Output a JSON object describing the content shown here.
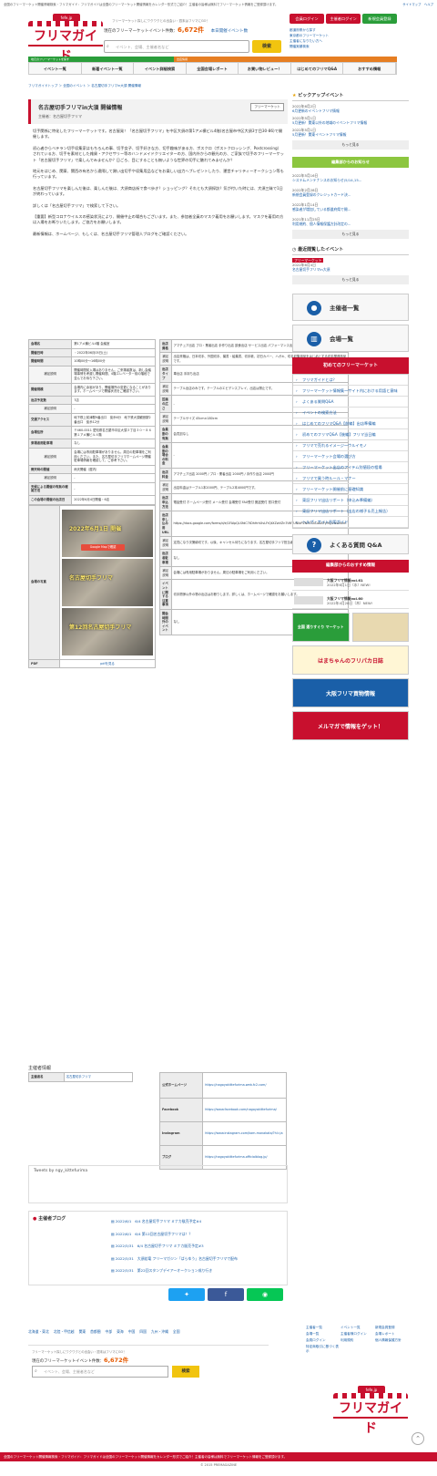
{
  "topbar": {
    "text": "全国のフリーマーケット開催情報検索・フリマガイド：フリマガイドは全国のフリーマーケット開催情報をカレンダー形式でご紹介！主催者の皆様は無料でフリーマーケット情報をご登録頂けます。",
    "links": "サイトマップ　ヘルプ"
  },
  "header": {
    "logo_small": "fefe.jp",
    "logo_text": "フリマガイド",
    "tagline": "フリーマーケット探しにワクワクとの出会い・週末はフリマにGO！",
    "count_label": "現在のフリーマーケットイベント件数：",
    "count_value": "6,672件",
    "count_link": "本日開催イベント数",
    "search_placeholder": "イベント、会場、主催者名など",
    "search_button": "検索",
    "btn_login": "会員ログイン",
    "btn_org_login": "主催者ログイン",
    "btn_register": "新規会員登録",
    "links": [
      "都道府県から探す",
      "東京都のフリーマーケット",
      "主催者になりたい方へ",
      "開催実績検索"
    ],
    "strip1": "地元のフリーマーケットを探す",
    "strip2": "出店情報"
  },
  "nav": [
    "イベント一覧",
    "新着イベント一覧",
    "イベント詳細検索",
    "全国会場レポート",
    "お買い物レビュー！",
    "はじめてのフリマQ&A",
    "おすすめ情報"
  ],
  "breadcrumb": "フリマガイドトップ ＞ 全国のイベント ＞ 名古屋切手フリマin大須 開催情報",
  "event": {
    "title": "名古屋切手フリマin大須 開催情報",
    "organizer_line": "主催者：名古屋切手フリマ",
    "tag": "フリーマーケット",
    "paragraphs": [
      "切手関係に特化したフリーマーケットです。名古屋発！「名古屋切手フリマ」を中区大須の第1アメ横ビル4階(名古屋市中区大須3丁目30-86)で開催します。",
      "初心者からベテラン切手収集家はもちろんの事、切手女子、切手好きな方、切手趣味がある方、ポスクロ（ポストクロッシング、Postcrossing）されている方、切手を素材とした雑貨・アクセサリー等のハンドメイドクリエイターの方、国内外からの観光の方、ご家族で切手のフリーマーケット「名古屋切手フリマ」で楽しんでみませんか？日ごろ、目にすることも無いような世界の切手に触れてみませんか？",
      "地元をはじめ、関東、関西の有名から遠隔して謝い出切手や収集用品などをお楽しい出力ヘブレゼントしたり、運営チャリティーオークション等も行っています。",
      "名古屋切手フリマを楽しんだ後は、楽しんだ後は、大須商店街で食べ歩き？ショッピング？それとも大須探訪？気が付いた時には、大須三昧で1日が終わっています。",
      "詳しくは「名古屋切手フリマ」で検索して下さい。",
      "【重要】新型コロナウイルスの感染状況により、開催中止の場合もございます。また、参加者全員のマスク着用をお願いします。マスクを着用の方は入場をお断りいたします。ご協力をお願いします。",
      "最新情報は、ホームページ、もしくは、名古屋切手フリマ管理人ブログをご確認ください。"
    ]
  },
  "left_table": [
    {
      "k": "会場名",
      "v": "第1アメ横ビル4階 会議室"
    },
    {
      "k": "開催日時",
      "v": "・2022年06月05日(土)"
    },
    {
      "k": "開催時間",
      "v": "10時00分〜16時00分"
    },
    {
      "k": "補足説明",
      "v": "開催時間前入場はありません。ご来場者数は、新し会議場事情を考慮し開催時間、4階エレベーター前の階段で並んでお待ち下さい。"
    },
    {
      "k": "開催規模",
      "v": "会場内に余裕があり、開催場所の変更になることがあります。ホームページで開催状況をご確認下さい。"
    },
    {
      "k": "出店予定数",
      "v": "7店"
    },
    {
      "k": "補足説明",
      "v": "-"
    },
    {
      "k": "交通アクセス",
      "v": "地下鉄上前津駅9番出口　徒歩6分　地下鉄大須観音駅2番出口　徒歩12分"
    },
    {
      "k": "会場住所",
      "v": "〒460-0011 愛知県名古屋市中区大須３丁目３０－８６ 第１アメ横ビル４階"
    },
    {
      "k": "来場者用駐車場",
      "v": "なし"
    },
    {
      "k": "補足説明",
      "v": "会場には専用駐車場がありません。周辺の駐車場をご利用ください。また、名古屋切手フリマホームページ開催駐車場情報を確認して、ご参考下さい。"
    },
    {
      "k": "雨天時の開催",
      "v": "雨天開催（屋内）"
    },
    {
      "k": "補足説明",
      "v": "-"
    },
    {
      "k": "天候による開催の有無の確認方法",
      "v": "-"
    },
    {
      "k": "この会場の開催の出店日",
      "v": "2022年6月4日開催・6店"
    }
  ],
  "photos": [
    "2022年6月1日 開催",
    "名古屋切手フリマ",
    "第12回名古屋切手フリマ"
  ],
  "pdf": {
    "k": "PDF",
    "v": "pdfを見る"
  },
  "map_btn": "Google Mapで確認",
  "right_table": [
    {
      "k": "出店資格",
      "v": "アマチュア出店 プロ・業者出店 手作り出店 飲食出店 サービス出店 パフォーマンス出店 企業出店"
    },
    {
      "k": "補足説明",
      "v": "出店資格は、日本切手、外国切手、葉書・絵葉書、切手帳、初日カバー、ハガキ、切手収集用品をはじめとする切手関連商品です。"
    },
    {
      "k": "出店タイプ",
      "v": "車出店 手持ち出店"
    },
    {
      "k": "補足説明",
      "v": "テーブル出店のみです。テーブルのエビデンスプレイ、出店は禁止です。"
    },
    {
      "k": "区画の広さ",
      "v": "-"
    },
    {
      "k": "補足説明",
      "v": "テーブルサイズ 45cm×180cm"
    },
    {
      "k": "会員割の有無",
      "v": "会員割なし"
    },
    {
      "k": "会員割の場合の料金",
      "v": "-"
    },
    {
      "k": "出店料金",
      "v": "アマチュア出店 2000円 / プロ・業者出店 2000円 / 手作り出店 2000円"
    },
    {
      "k": "補足説明",
      "v": "出店料金はテーブル1本2000円、テーブル2本4000円です。"
    },
    {
      "k": "出店申込方法",
      "v": "電話受付 ホームページ受付 メール受付 会場受付 FAX受付 郵送受付 窓口受付"
    },
    {
      "k": "出店申し込み用URL",
      "v": "https://docs.google.com/forms/d/e/1FAIpQLSfdC7tDhHrhXvLFrQtXZwVZn7tWYUNlbPZNATS4CabAPy9Q/viewform"
    },
    {
      "k": "補足説明",
      "v": "定員になり次第締切です。以後、キャンセル待ちになります。名古屋切手フリマ担当者のみで受付しております。"
    },
    {
      "k": "出店者駐車場",
      "v": "なし"
    },
    {
      "k": "補足説明",
      "v": "会場には専用駐車場がありません。周辺の駐車場をご利用ください。"
    },
    {
      "k": "イベントに関する注意事項",
      "v": "切手関係以外の物の出店はお断りします。詳しくは、ホームページで確認をお願いします。"
    },
    {
      "k": "開会時間外のイベント",
      "v": "なし"
    }
  ],
  "organizer_info": {
    "heading": "主催者情報",
    "rows": [
      {
        "k": "主催者名",
        "v": "名古屋切手フリマ"
      },
      {
        "k": "公式ホームページ",
        "v": "https://nagoyakittefurima.web.fc2.com/"
      },
      {
        "k": "Facebook",
        "v": "https://www.facebook.com/nagoyakittefurima/"
      },
      {
        "k": "Instagram",
        "v": "https://www.instagram.com/kam-monakata/?hl=ja"
      },
      {
        "k": "ブログ",
        "v": "https://nagoyakittefurima.officialblog.jp/"
      }
    ]
  },
  "tweets": "Tweets by ngy_kittefurima",
  "blog": {
    "heading": "主催者ブログ",
    "items": [
      "2022/6/1　6/4 名古屋切手フリマ ミナカ駄売予定#4",
      "2022/6/1　6/4 第12回名古屋切手フリマは！？",
      "2022/5/31　6/4 名古屋切手フリマ ミナカ販売予定#3",
      "2022/5/31　大須若竜 フリーマガジン「ぱらゆう」名古屋切手フリマで配布",
      "2022/5/31　第22回スタンプデイアーオークション成り行き"
    ]
  },
  "sidebar": {
    "pickup_heading": "ピックアップイベント",
    "pickup": [
      {
        "d": "2022年6月2日",
        "l": "6月更新のイベントフリマ情報"
      },
      {
        "d": "2022年5月1日",
        "l": "5月更新！関東以外の地域のイベントフリマ情報"
      },
      {
        "d": "2022年5月1日",
        "l": "5月更新！関東イベントフリマ情報"
      }
    ],
    "more": "もっと見る",
    "news_heading": "編集部からのお知らせ",
    "news": [
      {
        "d": "2022年5月16日",
        "l": "システムメンテナンスのお知らせ(5/14,15..."
      },
      {
        "d": "2022年2月28日",
        "l": "新規会員登録のクレジットカード決..."
      },
      {
        "d": "2022年1月14日",
        "l": "感染者が増加している都道府県で開..."
      },
      {
        "d": "2021年11月25日",
        "l": "利用規約、個人情報保護方針改定の..."
      }
    ],
    "recent_heading": "最近閲覧したイベント",
    "recent_tag": "フリーマーケット",
    "recent_date": "2022年6月4日",
    "recent_link": "名古屋切手フリマin大須",
    "btn_organizers": "主催者一覧",
    "btn_venues": "会場一覧",
    "first_heading": "初めてのフリーマーケット",
    "first_links": [
      "フリマガイドとは？",
      "フリーマーケット情報集〜サイト内における用語と意味",
      "よくある質問Q&A",
      "イベントの検索方法",
      "はじめてのフリマQ&A【前編】出店準備編",
      "初めてのフリマQ&A【後編】フリマ当日編",
      "フリマで売れるイメージ〜ウルイモノ",
      "フリーマーケット会場の選び方",
      "フリーマーケット出店のアイテム別値段の相場",
      "フリマで買う時ルール・マナー",
      "フリーマーケット開催前に基礎知識",
      "東証フリマ出店リポート（申込み準備編）",
      "東証フリマ出店リポート（出店の様子＆売上報告）",
      "ヘルプ・サイト利用ガイド"
    ],
    "qa_btn": "よくある質問 Q&A",
    "mag_heading": "編集部からのおすすめ情報",
    "mags": [
      {
        "t": "大阪フリマ情報vol.61",
        "d": "2022年6月1日（水）NEW!"
      },
      {
        "t": "大阪フリマ情報vol.60",
        "d": "2022年4月28日（木）NEW!"
      }
    ],
    "banners": [
      "全国 選りすぐり マーケット",
      "はまちゃんのフリパカ日誌",
      "大阪フリマ買物情報",
      "メルマガで情報をゲット！"
    ]
  },
  "footer": {
    "nav": [
      "北海道・東北",
      "北陸・甲信越",
      "関東",
      "首都圏",
      "中部",
      "東海",
      "中国",
      "四国",
      "九州・沖縄",
      "全国"
    ],
    "links": [
      "主催者一覧",
      "イベント一覧",
      "新規会員登録",
      "会場一覧",
      "主催者様ログイン",
      "会場レポート",
      "会員ログイン",
      "利用規約",
      "個人情報保護方針",
      "特定商取引に基づく表示"
    ],
    "red": "全国のフリーマーケット開催情報検索・フリマガイド：フリマガイドは全国のフリーマーケット開催情報をカレンダー形式でご紹介！主催者の皆様は無料でフリーマーケット情報をご登録頂けます。",
    "copy": "© 2015 PREMAGAZINE"
  },
  "colors": {
    "brand": "#c8102e",
    "accent": "#f1c40f",
    "link": "#1a5fa8",
    "green": "#8cc63f",
    "orange": "#e65a00"
  }
}
